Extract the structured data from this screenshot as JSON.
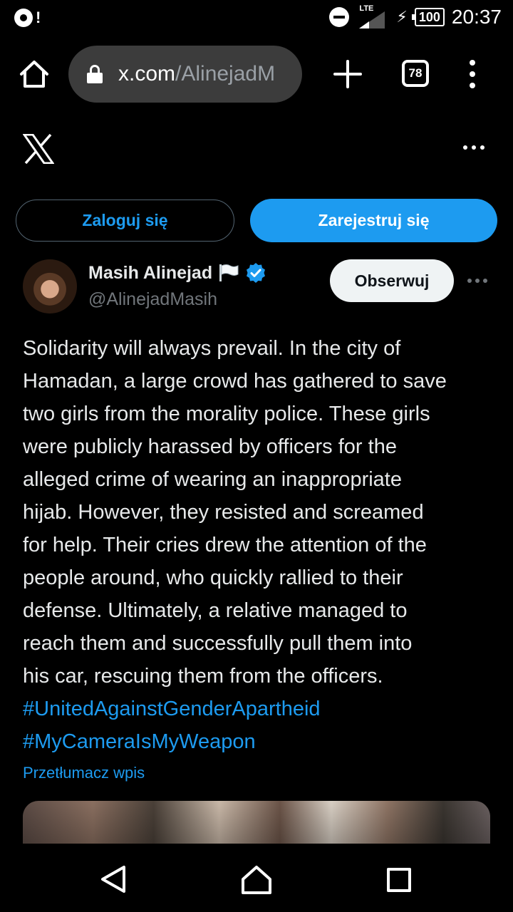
{
  "status_bar": {
    "notification_symbol": "!",
    "network": "LTE",
    "battery": "100",
    "time": "20:37"
  },
  "browser": {
    "url_domain": "x.com",
    "url_path": "/AlinejadM",
    "tab_count": "78",
    "icons": [
      "home-icon",
      "lock-icon",
      "plus-icon",
      "tabs-icon",
      "more-vert-icon"
    ]
  },
  "header": {
    "login_label": "Zaloguj się",
    "signup_label": "Zarejestruj się",
    "accent_color": "#1d9bf0"
  },
  "tweet": {
    "author_name": "Masih Alinejad",
    "author_handle": "@AlinejadMasih",
    "follow_label": "Obserwuj",
    "text_lines": [
      "Solidarity will always prevail. In the city of",
      "Hamadan, a large crowd has gathered to save",
      "two girls from the morality police. These girls",
      "were publicly harassed by officers for the",
      "alleged crime of wearing an inappropriate",
      "hijab. However, they resisted and screamed",
      "for help. Their cries drew the attention of the",
      "people around, who quickly rallied to their",
      "defense. Ultimately, a relative managed to",
      "reach them and successfully pull them into",
      "his car, rescuing them from the officers."
    ],
    "hashtags": [
      "#UnitedAgainstGenderApartheid",
      "#MyCameraIsMyWeapon"
    ],
    "translate_label": "Przetłumacz wpis"
  }
}
